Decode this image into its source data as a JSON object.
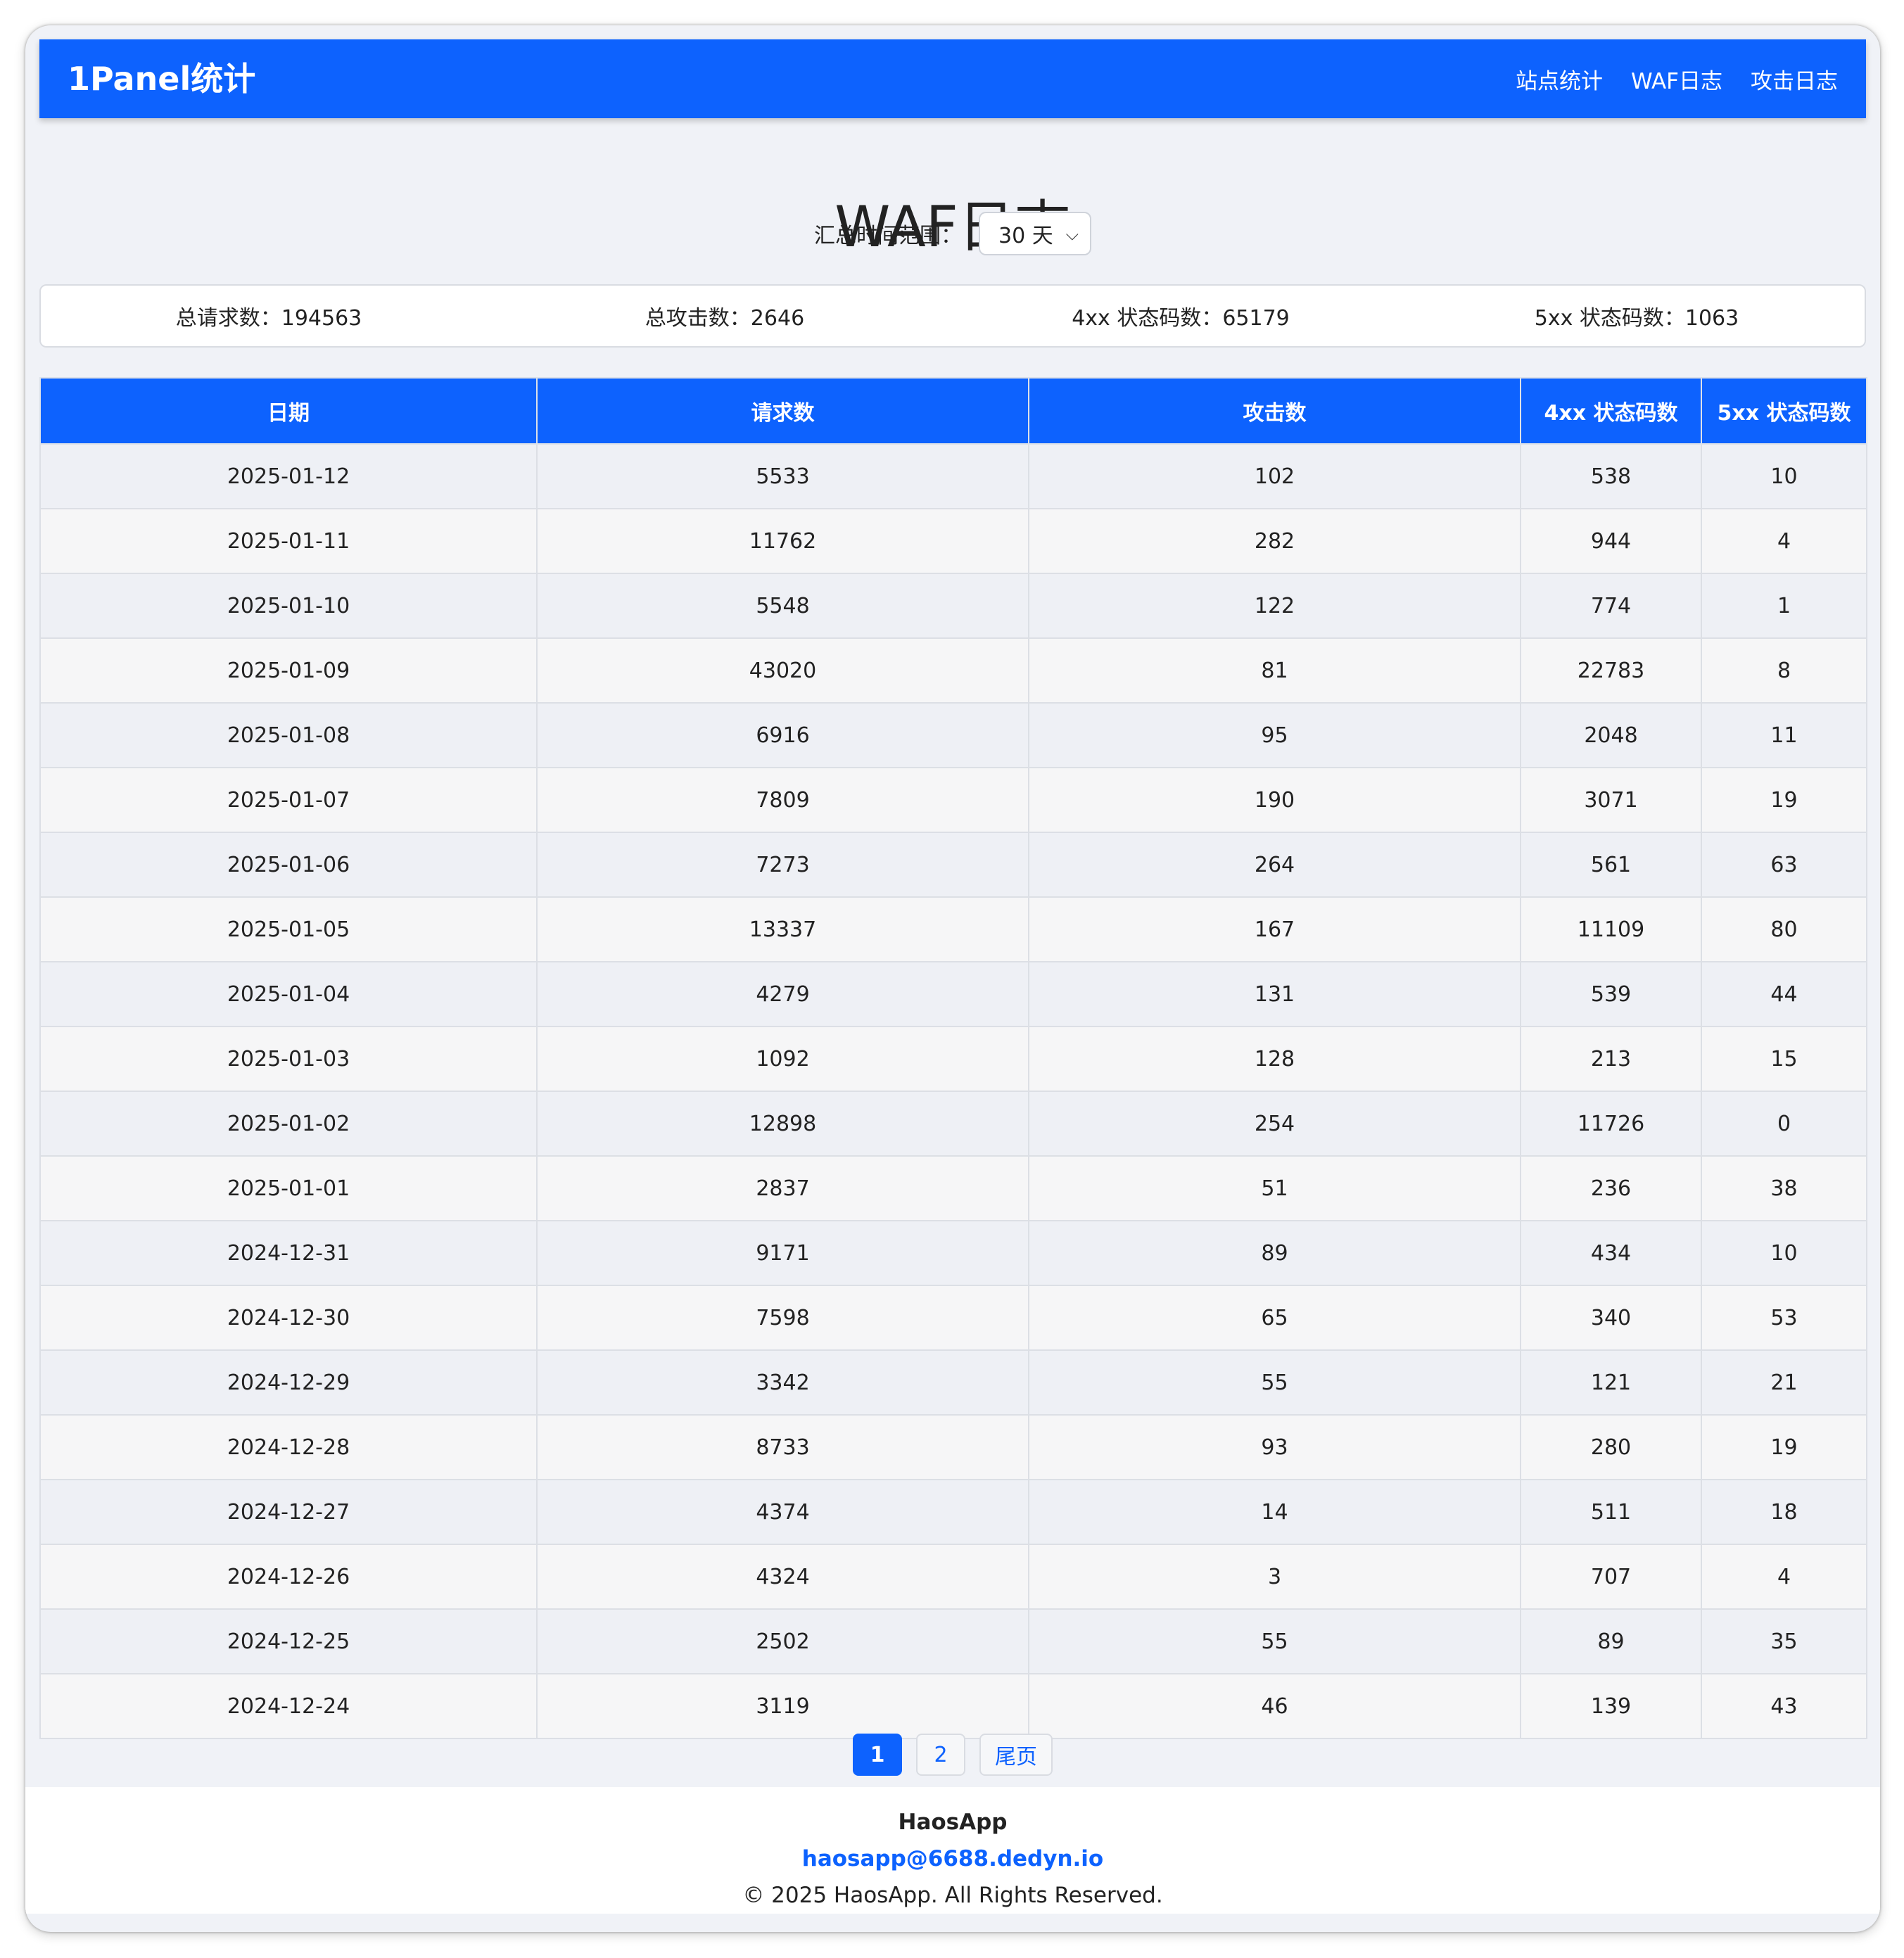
{
  "nav": {
    "brand": "1Panel统计",
    "links": [
      "站点统计",
      "WAF日志",
      "攻击日志"
    ]
  },
  "page_title": "WAF日志",
  "range": {
    "label": "汇总时间范围：",
    "selected": "30 天"
  },
  "summary": [
    "总请求数：194563",
    "总攻击数：2646",
    "4xx 状态码数：65179",
    "5xx 状态码数：1063"
  ],
  "table": {
    "headers": [
      "日期",
      "请求数",
      "攻击数",
      "4xx 状态码数",
      "5xx 状态码数"
    ],
    "rows": [
      [
        "2025-01-12",
        "5533",
        "102",
        "538",
        "10"
      ],
      [
        "2025-01-11",
        "11762",
        "282",
        "944",
        "4"
      ],
      [
        "2025-01-10",
        "5548",
        "122",
        "774",
        "1"
      ],
      [
        "2025-01-09",
        "43020",
        "81",
        "22783",
        "8"
      ],
      [
        "2025-01-08",
        "6916",
        "95",
        "2048",
        "11"
      ],
      [
        "2025-01-07",
        "7809",
        "190",
        "3071",
        "19"
      ],
      [
        "2025-01-06",
        "7273",
        "264",
        "561",
        "63"
      ],
      [
        "2025-01-05",
        "13337",
        "167",
        "11109",
        "80"
      ],
      [
        "2025-01-04",
        "4279",
        "131",
        "539",
        "44"
      ],
      [
        "2025-01-03",
        "1092",
        "128",
        "213",
        "15"
      ],
      [
        "2025-01-02",
        "12898",
        "254",
        "11726",
        "0"
      ],
      [
        "2025-01-01",
        "2837",
        "51",
        "236",
        "38"
      ],
      [
        "2024-12-31",
        "9171",
        "89",
        "434",
        "10"
      ],
      [
        "2024-12-30",
        "7598",
        "65",
        "340",
        "53"
      ],
      [
        "2024-12-29",
        "3342",
        "55",
        "121",
        "21"
      ],
      [
        "2024-12-28",
        "8733",
        "93",
        "280",
        "19"
      ],
      [
        "2024-12-27",
        "4374",
        "14",
        "511",
        "18"
      ],
      [
        "2024-12-26",
        "4324",
        "3",
        "707",
        "4"
      ],
      [
        "2024-12-25",
        "2502",
        "55",
        "89",
        "35"
      ],
      [
        "2024-12-24",
        "3119",
        "46",
        "139",
        "43"
      ]
    ]
  },
  "pagination": {
    "pages": [
      "1",
      "2"
    ],
    "current": "1",
    "last_label": "尾页"
  },
  "footer": {
    "name": "HaosApp",
    "email": "haosapp@6688.dedyn.io",
    "copyright": "© 2025 HaosApp. All Rights Reserved."
  },
  "colors": {
    "accent": "#0d62fe",
    "background": "#f0f2f7"
  }
}
